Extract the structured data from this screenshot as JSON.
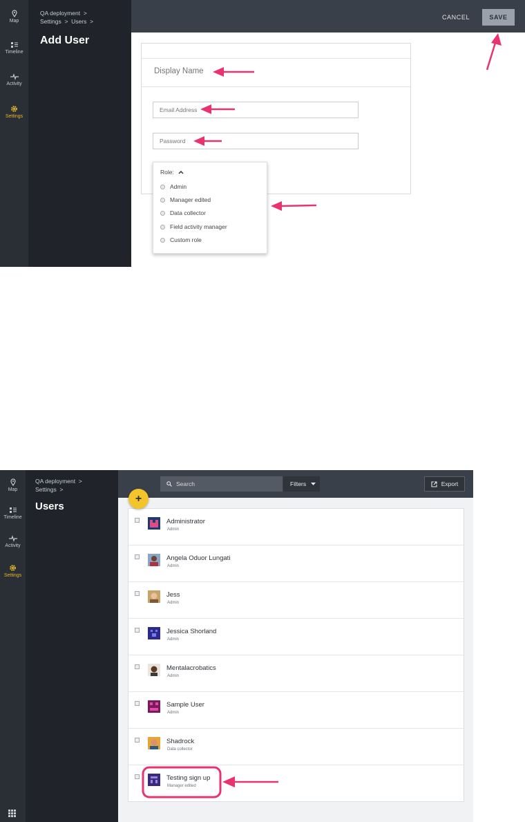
{
  "add_user_screen": {
    "rail": [
      {
        "label": "Map",
        "icon": "map-pin-icon"
      },
      {
        "label": "Timeline",
        "icon": "timeline-icon"
      },
      {
        "label": "Activity",
        "icon": "activity-icon"
      },
      {
        "label": "Settings",
        "icon": "gear-icon",
        "active": true
      }
    ],
    "breadcrumb": {
      "deployment": "QA deployment",
      "settings": "Settings",
      "users": "Users",
      "separator": ">"
    },
    "title": "Add User",
    "actions": {
      "cancel": "CANCEL",
      "save": "SAVE"
    },
    "form": {
      "display_name_placeholder": "Display Name",
      "email_placeholder": "Email Address",
      "password_placeholder": "Password"
    },
    "role_dropdown": {
      "label": "Role:",
      "options": [
        "Admin",
        "Manager edited",
        "Data collector",
        "Field activity manager",
        "Custom role"
      ]
    }
  },
  "users_screen": {
    "rail": [
      {
        "label": "Map",
        "icon": "map-pin-icon"
      },
      {
        "label": "Timeline",
        "icon": "timeline-icon"
      },
      {
        "label": "Activity",
        "icon": "activity-icon"
      },
      {
        "label": "Settings",
        "icon": "gear-icon",
        "active": true
      }
    ],
    "breadcrumb": {
      "deployment": "QA deployment",
      "settings": "Settings",
      "separator": ">"
    },
    "title": "Users",
    "search_placeholder": "Search",
    "filters_label": "Filters",
    "export_label": "Export",
    "add_button": "+",
    "users": [
      {
        "name": "Administrator",
        "role": "Admin",
        "avatar": "identicon-pink"
      },
      {
        "name": "Angela Oduor Lungati",
        "role": "Admin",
        "avatar": "photo-angela"
      },
      {
        "name": "Jess",
        "role": "Admin",
        "avatar": "photo-jess"
      },
      {
        "name": "Jessica Shorland",
        "role": "Admin",
        "avatar": "identicon-purple"
      },
      {
        "name": "Mentalacrobatics",
        "role": "Admin",
        "avatar": "photo-mental"
      },
      {
        "name": "Sample User",
        "role": "Admin",
        "avatar": "identicon-magenta"
      },
      {
        "name": "Shadrock",
        "role": "Data collector",
        "avatar": "photo-shadrock"
      },
      {
        "name": "Testing sign up",
        "role": "Manager edited",
        "avatar": "identicon-violet"
      }
    ]
  },
  "colors": {
    "rail": "#2a2f36",
    "nav_panel": "#20242a",
    "topbar": "#3a4049",
    "accent_yellow": "#f4c52a",
    "active_settings": "#e7b62a",
    "annotation_pink": "#e8336f"
  }
}
